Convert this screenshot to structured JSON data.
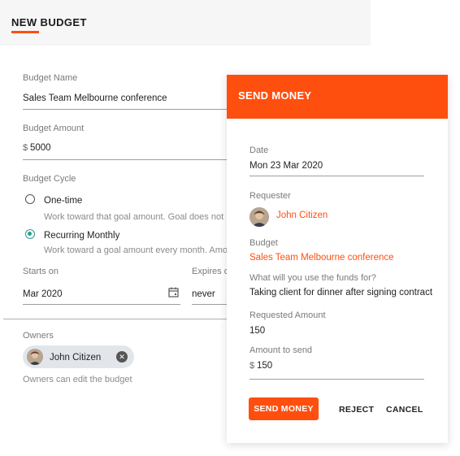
{
  "budget_form": {
    "title": "NEW BUDGET",
    "name_label": "Budget Name",
    "name_value": "Sales Team Melbourne conference",
    "amount_label": "Budget Amount",
    "amount_currency": "$",
    "amount_value": "5000",
    "cycle_label": "Budget Cycle",
    "cycle_options": [
      {
        "label": "One-time",
        "description": "Work toward that goal amount. Goal does not",
        "selected": false
      },
      {
        "label": "Recurring Monthly",
        "description": "Work toward a goal amount every month. Amo",
        "selected": true
      }
    ],
    "starts_label": "Starts on",
    "starts_value": "Mar 2020",
    "expires_label": "Expires on",
    "expires_value": "never",
    "owners_label": "Owners",
    "owner_name": "John Citizen",
    "owners_hint": "Owners can edit the budget"
  },
  "send_money": {
    "title": "SEND MONEY",
    "date_label": "Date",
    "date_value": "Mon 23 Mar 2020",
    "requester_label": "Requester",
    "requester_name": "John Citizen",
    "budget_label": "Budget",
    "budget_value": "Sales Team Melbourne conference",
    "purpose_label": "What will you use the funds for?",
    "purpose_value": "Taking client for dinner after signing contract",
    "requested_label": "Requested Amount",
    "requested_value": "150",
    "send_label": "Amount to send",
    "send_currency": "$",
    "send_value": "150",
    "send_button": "SEND MONEY",
    "reject_button": "REJECT",
    "cancel_button": "CANCEL"
  },
  "colors": {
    "accent": "#ff4f0f",
    "radio_selected": "#2d9c8f"
  },
  "icons": {
    "calendar": "calendar-icon",
    "close": "close-icon",
    "avatar": "avatar"
  }
}
